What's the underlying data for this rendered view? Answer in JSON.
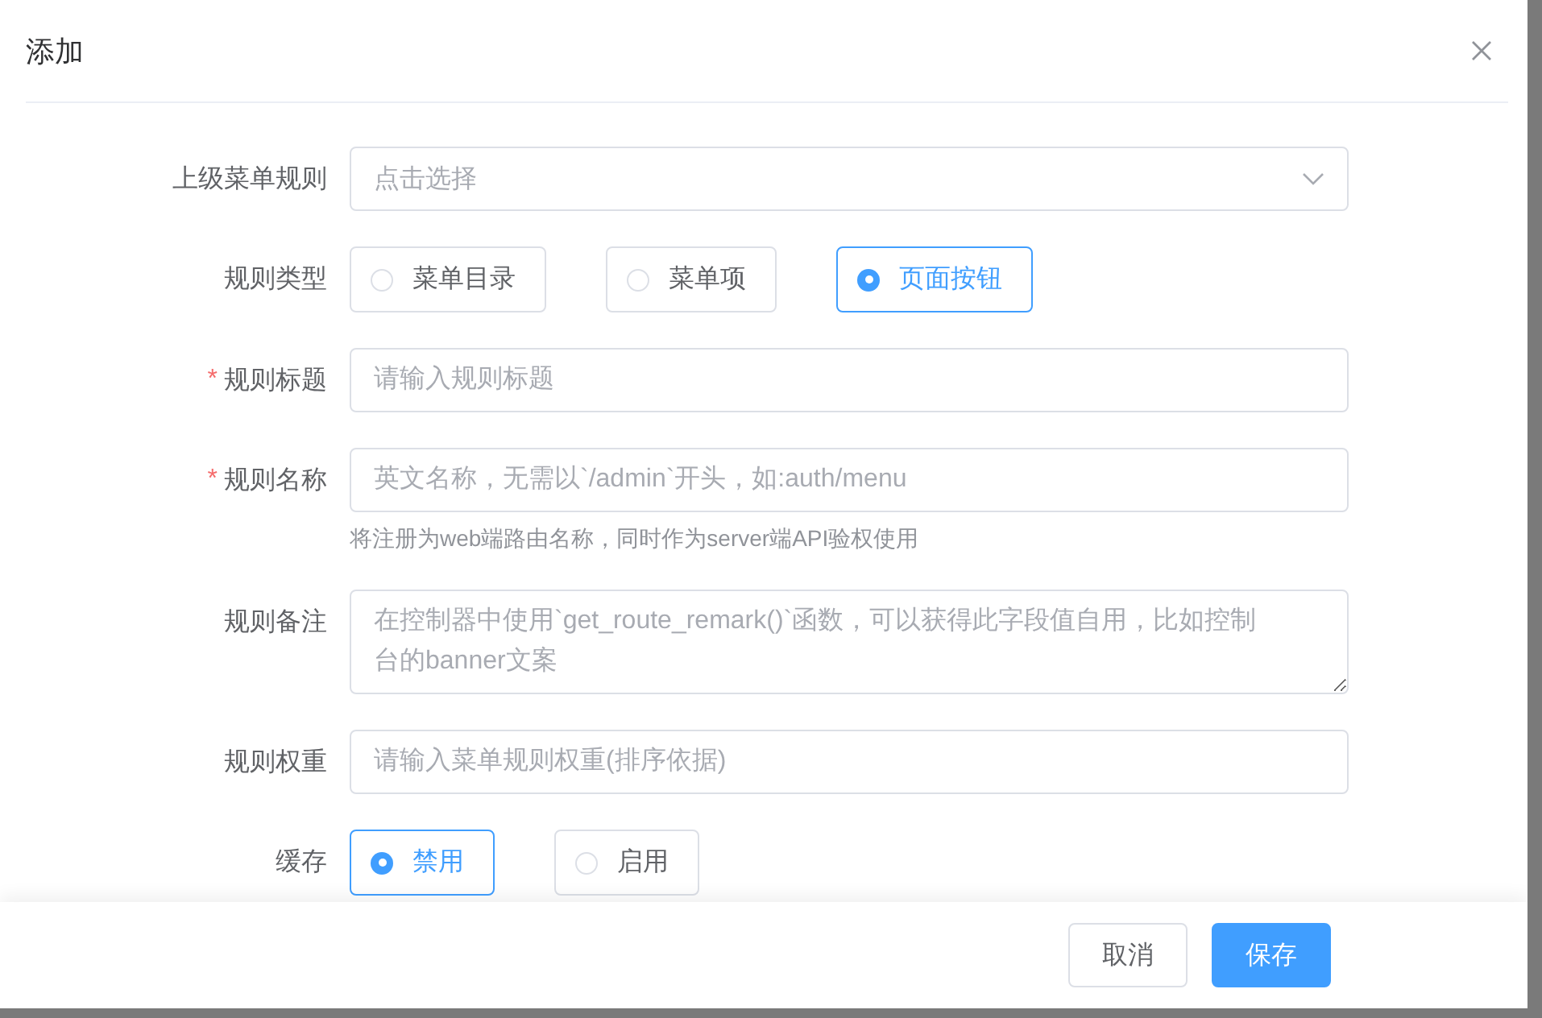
{
  "dialog": {
    "title": "添加"
  },
  "fields": [
    {
      "kind": "select",
      "label": "上级菜单规则",
      "placeholder": "点击选择"
    },
    {
      "kind": "radio",
      "label": "规则类型",
      "options": [
        {
          "label": "菜单目录",
          "selected": false
        },
        {
          "label": "菜单项",
          "selected": false
        },
        {
          "label": "页面按钮",
          "selected": true
        }
      ]
    },
    {
      "kind": "input",
      "label": "规则标题",
      "required_mark": "*",
      "placeholder": "请输入规则标题"
    },
    {
      "kind": "input",
      "label": "规则名称",
      "required_mark": "*",
      "placeholder": "英文名称，无需以`/admin`开头，如:auth/menu",
      "help": "将注册为web端路由名称，同时作为server端API验权使用"
    },
    {
      "kind": "textarea",
      "label": "规则备注",
      "placeholder": "在控制器中使用`get_route_remark()`函数，可以获得此字段值自用，比如控制台的banner文案"
    },
    {
      "kind": "input",
      "label": "规则权重",
      "placeholder": "请输入菜单规则权重(排序依据)"
    },
    {
      "kind": "radio",
      "label": "缓存",
      "options": [
        {
          "label": "禁用",
          "selected": true
        },
        {
          "label": "启用",
          "selected": false
        }
      ]
    }
  ],
  "footer": {
    "buttons": [
      {
        "label": "取消",
        "kind": "default"
      },
      {
        "label": "保存",
        "kind": "primary"
      }
    ]
  }
}
